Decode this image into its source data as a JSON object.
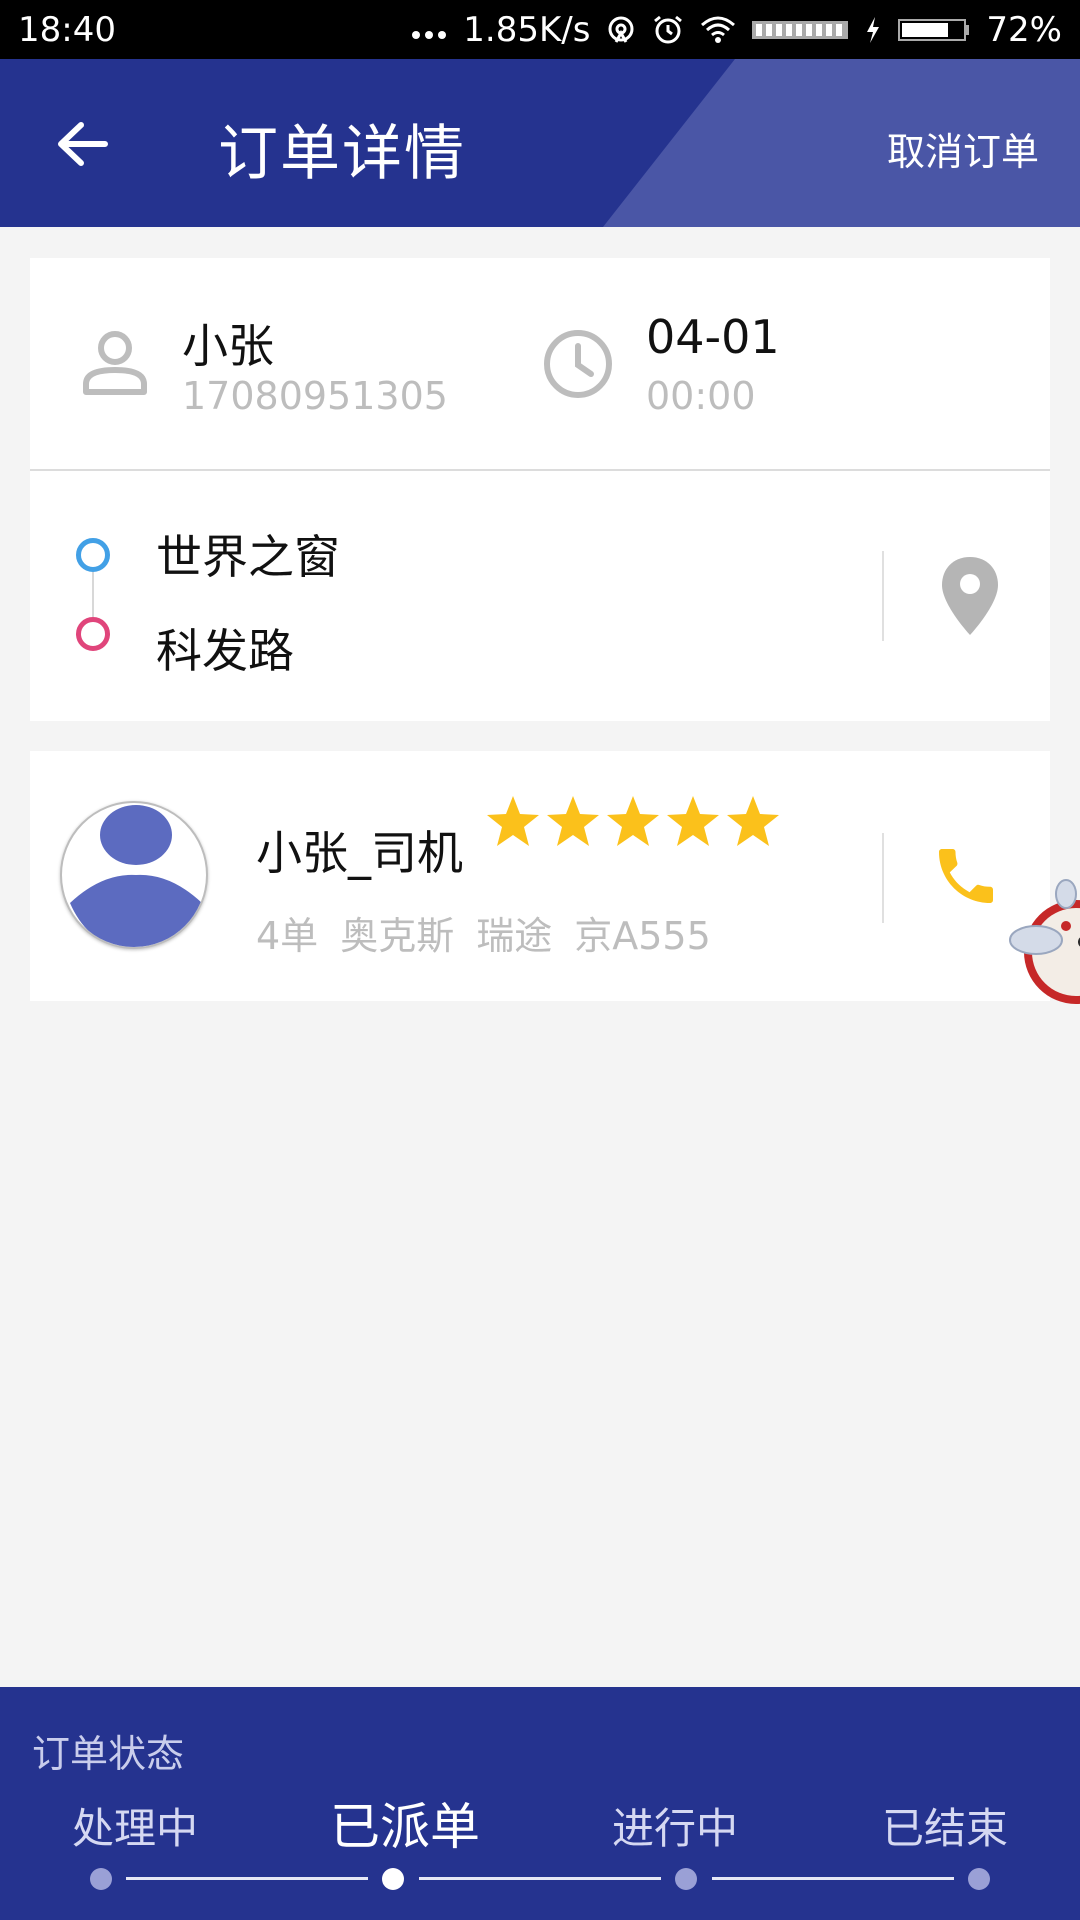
{
  "status_bar": {
    "time": "18:40",
    "network_speed": "1.85K/s",
    "battery": "72%",
    "icons": [
      "more-dots-icon",
      "hotspot-icon",
      "alarm-icon",
      "wifi-icon",
      "signal-icon",
      "charging-icon",
      "battery-icon"
    ]
  },
  "header": {
    "back_icon": "arrow-left-icon",
    "title": "订单详情",
    "cancel_label": "取消订单",
    "colors": {
      "primary": "#25338f",
      "accent": "#4a56a6"
    }
  },
  "passenger": {
    "icon": "person-icon",
    "name": "小张",
    "phone": "17080951305"
  },
  "schedule": {
    "icon": "clock-icon",
    "date": "04-01",
    "time": "00:00"
  },
  "route": {
    "start": "世界之窗",
    "end": "科发路",
    "start_color": "#42a0e6",
    "end_color": "#e0457b",
    "map_icon": "location-pin-icon"
  },
  "driver": {
    "avatar_icon": "avatar-icon",
    "name": "小张_司机",
    "rating": 5,
    "rating_max": 5,
    "orders": "4单",
    "brand": "奥克斯",
    "model": "瑞途",
    "plate": "京A555",
    "phone_icon": "phone-icon",
    "star_color": "#fbc11b"
  },
  "order_status": {
    "label": "订单状态",
    "steps": [
      "处理中",
      "已派单",
      "进行中",
      "已结束"
    ],
    "current_index": 1
  }
}
